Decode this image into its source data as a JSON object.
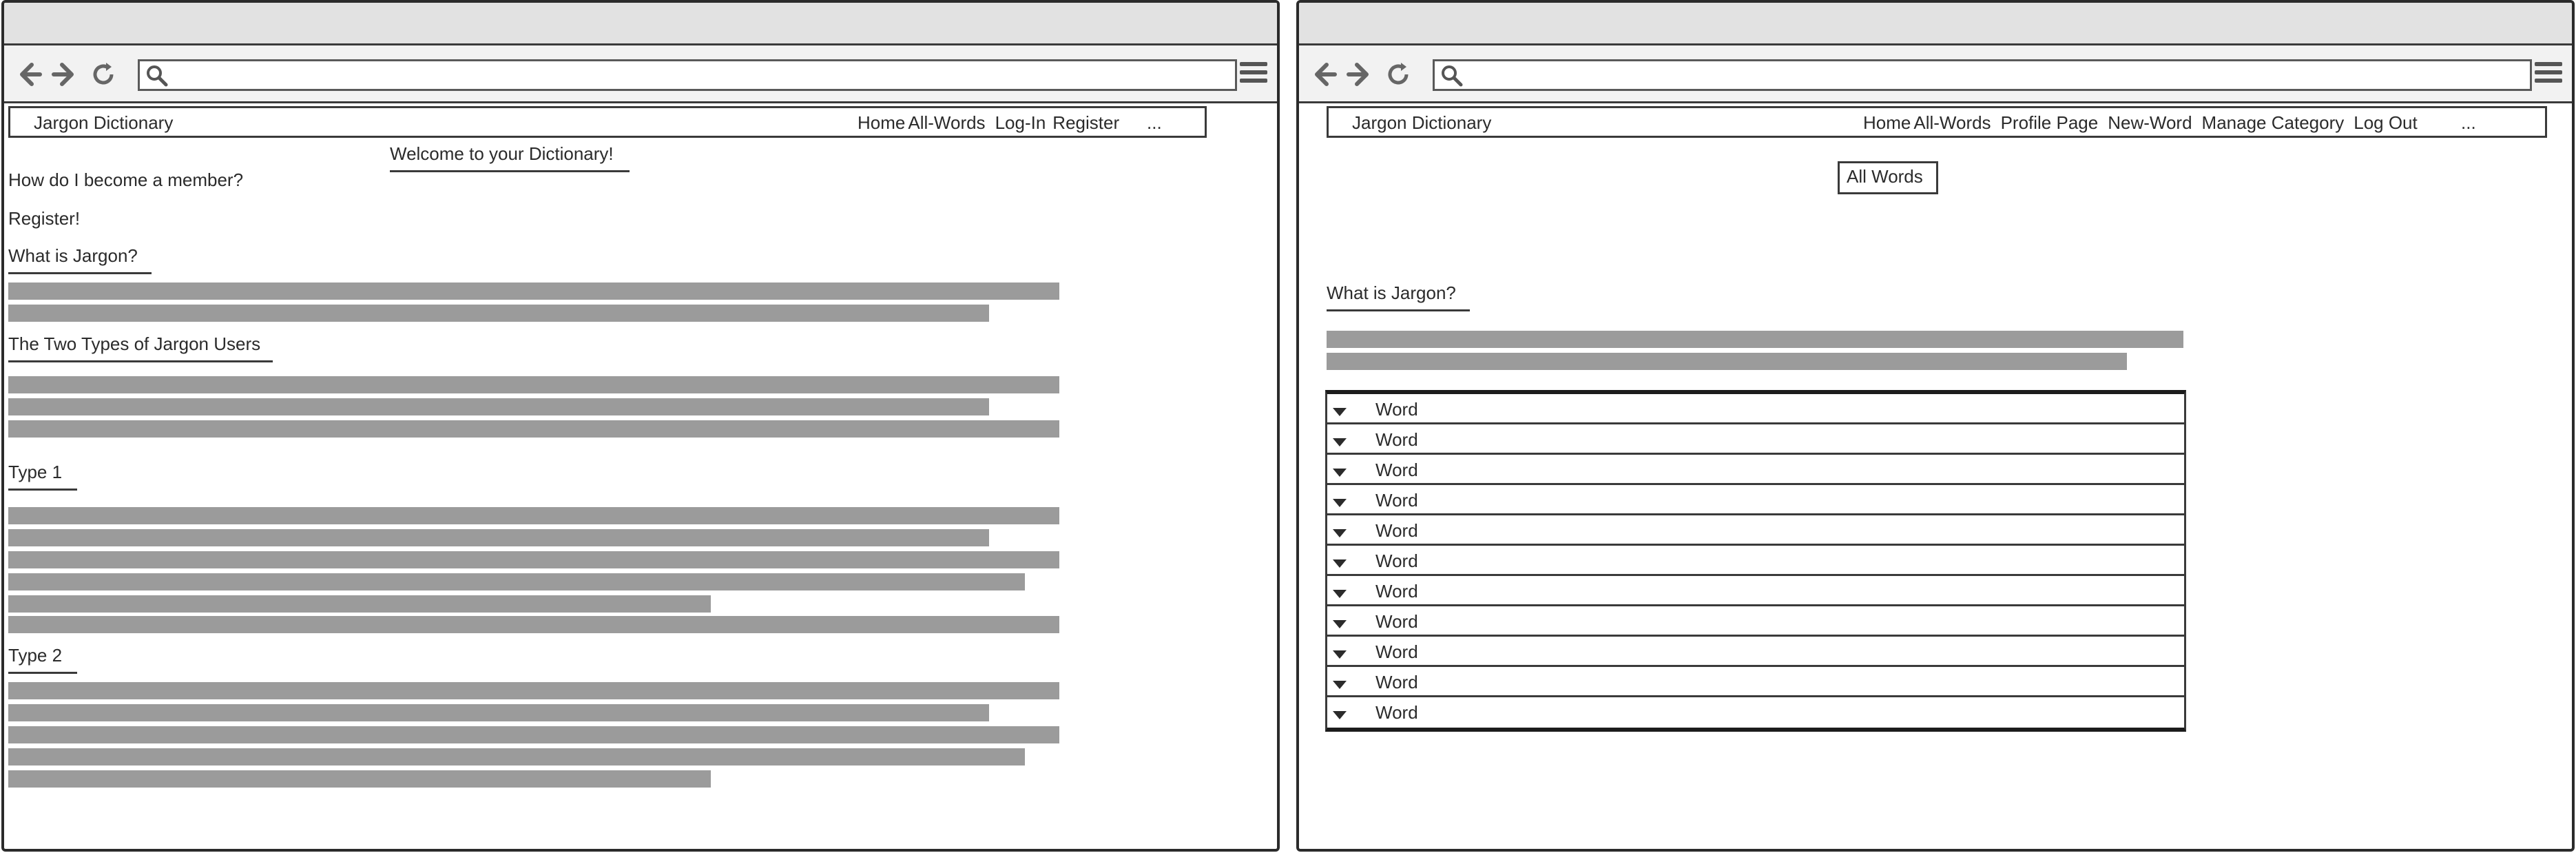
{
  "left_window": {
    "url_value": "",
    "site_brand": "Jargon Dictionary",
    "nav_links": [
      "Home",
      "All-Words",
      "Log-In",
      "Register"
    ],
    "nav_more": "...",
    "welcome": "Welcome to your Dictionary!",
    "question": "How do I become  a member?",
    "register_link": "Register!",
    "section_what": "What is Jargon?",
    "section_types": "The Two Types of Jargon Users",
    "section_type1": "Type 1",
    "section_type2": "Type 2"
  },
  "right_window": {
    "url_value": "",
    "site_brand": "Jargon Dictionary",
    "nav_links": [
      "Home",
      "All-Words",
      "Profile Page",
      "New-Word",
      "Manage Category",
      "Log Out"
    ],
    "nav_more": "...",
    "all_words_title": "All Words",
    "section_what": "What is Jargon?",
    "words": [
      "Word",
      "Word",
      "Word",
      "Word",
      "Word",
      "Word",
      "Word",
      "Word",
      "Word",
      "Word",
      "Word"
    ]
  },
  "icons": {
    "back": "arrow-left-icon",
    "forward": "arrow-right-icon",
    "reload": "reload-icon",
    "search": "search-icon",
    "menu": "hamburger-menu-icon",
    "expand": "caret-down-icon"
  },
  "colors": {
    "placeholder_bar": "#9b9b9b",
    "frame": "#2b2b2b",
    "titlebar": "#e2e2e2"
  }
}
